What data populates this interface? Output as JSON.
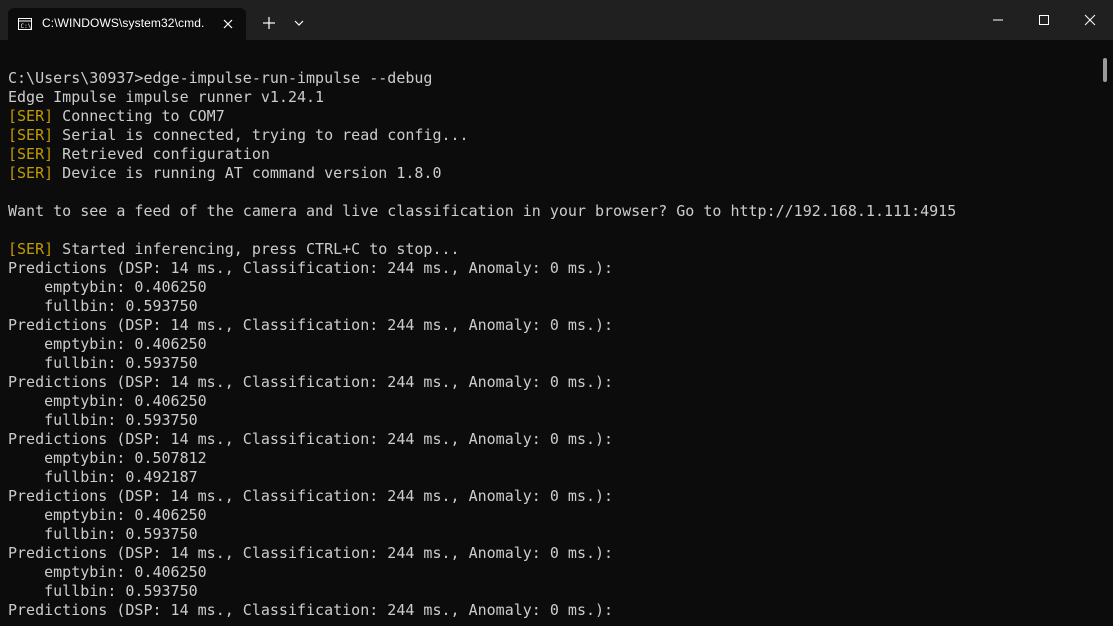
{
  "window": {
    "tab_title": "C:\\WINDOWS\\system32\\cmd.",
    "icons": {
      "tab": "terminal-icon",
      "tab_close": "close-icon",
      "new_tab": "plus-icon",
      "dropdown": "chevron-down-icon",
      "minimize": "minimize-icon",
      "maximize": "maximize-icon",
      "close": "close-icon"
    }
  },
  "colors": {
    "background": "#0c0c0c",
    "titlebar": "#202020",
    "text": "#cccccc",
    "ser_tag": "#c19c00"
  },
  "terminal": {
    "lines": [
      {
        "tag": "",
        "text": "C:\\Users\\30937>edge-impulse-run-impulse --debug"
      },
      {
        "tag": "",
        "text": "Edge Impulse impulse runner v1.24.1"
      },
      {
        "tag": "[SER]",
        "text": " Connecting to COM7"
      },
      {
        "tag": "[SER]",
        "text": " Serial is connected, trying to read config..."
      },
      {
        "tag": "[SER]",
        "text": " Retrieved configuration"
      },
      {
        "tag": "[SER]",
        "text": " Device is running AT command version 1.8.0"
      },
      {
        "tag": "",
        "text": ""
      },
      {
        "tag": "",
        "text": "Want to see a feed of the camera and live classification in your browser? Go to http://192.168.1.111:4915"
      },
      {
        "tag": "",
        "text": ""
      },
      {
        "tag": "[SER]",
        "text": " Started inferencing, press CTRL+C to stop..."
      },
      {
        "tag": "",
        "text": "Predictions (DSP: 14 ms., Classification: 244 ms., Anomaly: 0 ms.):"
      },
      {
        "tag": "",
        "text": "    emptybin: 0.406250"
      },
      {
        "tag": "",
        "text": "    fullbin: 0.593750"
      },
      {
        "tag": "",
        "text": "Predictions (DSP: 14 ms., Classification: 244 ms., Anomaly: 0 ms.):"
      },
      {
        "tag": "",
        "text": "    emptybin: 0.406250"
      },
      {
        "tag": "",
        "text": "    fullbin: 0.593750"
      },
      {
        "tag": "",
        "text": "Predictions (DSP: 14 ms., Classification: 244 ms., Anomaly: 0 ms.):"
      },
      {
        "tag": "",
        "text": "    emptybin: 0.406250"
      },
      {
        "tag": "",
        "text": "    fullbin: 0.593750"
      },
      {
        "tag": "",
        "text": "Predictions (DSP: 14 ms., Classification: 244 ms., Anomaly: 0 ms.):"
      },
      {
        "tag": "",
        "text": "    emptybin: 0.507812"
      },
      {
        "tag": "",
        "text": "    fullbin: 0.492187"
      },
      {
        "tag": "",
        "text": "Predictions (DSP: 14 ms., Classification: 244 ms., Anomaly: 0 ms.):"
      },
      {
        "tag": "",
        "text": "    emptybin: 0.406250"
      },
      {
        "tag": "",
        "text": "    fullbin: 0.593750"
      },
      {
        "tag": "",
        "text": "Predictions (DSP: 14 ms., Classification: 244 ms., Anomaly: 0 ms.):"
      },
      {
        "tag": "",
        "text": "    emptybin: 0.406250"
      },
      {
        "tag": "",
        "text": "    fullbin: 0.593750"
      },
      {
        "tag": "",
        "text": "Predictions (DSP: 14 ms., Classification: 244 ms., Anomaly: 0 ms.):"
      }
    ]
  }
}
